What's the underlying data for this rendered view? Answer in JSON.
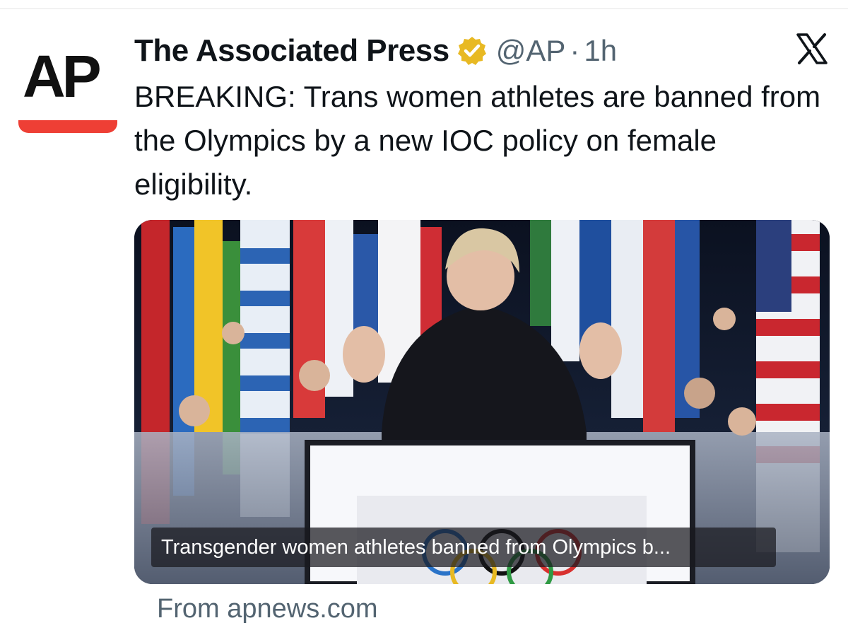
{
  "tweet": {
    "author_name": "The Associated Press",
    "handle": "@AP",
    "separator": "·",
    "time": "1h",
    "text": "BREAKING: Trans women athletes are banned from the Olympics by a new IOC policy on female eligibility.",
    "logo_text": "AP"
  },
  "card": {
    "caption": "Transgender women athletes banned from Olympics b...",
    "source": "From apnews.com"
  },
  "icons": {
    "verified": "verified-gold-badge-icon",
    "platform": "x-logo-icon"
  },
  "colors": {
    "ap_red": "#ee3f35",
    "verified_gold": "#e8b923",
    "secondary_text": "#536471",
    "primary_text": "#0f1419"
  }
}
